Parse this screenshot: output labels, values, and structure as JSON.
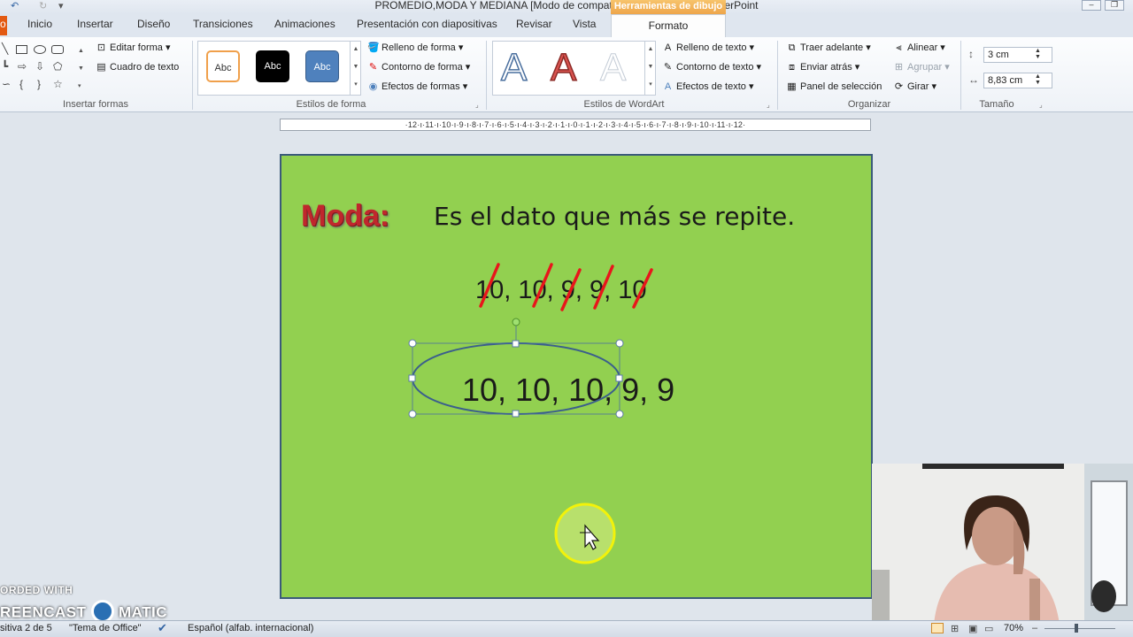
{
  "window": {
    "title": "PROMEDIO,MODA Y MEDIANA [Modo de compatibilidad]  -  Microsoft PowerPoint",
    "contextual_title": "Herramientas de dibujo"
  },
  "tabs": [
    {
      "label": "o"
    },
    {
      "label": "Inicio"
    },
    {
      "label": "Insertar"
    },
    {
      "label": "Diseño"
    },
    {
      "label": "Transiciones"
    },
    {
      "label": "Animaciones"
    },
    {
      "label": "Presentación con diapositivas"
    },
    {
      "label": "Revisar"
    },
    {
      "label": "Vista"
    },
    {
      "label": "Formato"
    }
  ],
  "ribbon": {
    "insertar_formas": {
      "label": "Insertar formas",
      "editar_forma": "Editar forma",
      "cuadro_texto": "Cuadro de texto"
    },
    "estilos_forma": {
      "label": "Estilos de forma",
      "samples": [
        "Abc",
        "Abc",
        "Abc"
      ],
      "relleno": "Relleno de forma",
      "contorno": "Contorno de forma",
      "efectos": "Efectos de formas"
    },
    "estilos_wordart": {
      "label": "Estilos de WordArt",
      "sample_letter": "A",
      "relleno_texto": "Relleno de texto",
      "contorno_texto": "Contorno de texto",
      "efectos_texto": "Efectos de texto"
    },
    "organizar": {
      "label": "Organizar",
      "traer_adelante": "Traer adelante",
      "enviar_atras": "Enviar atrás",
      "panel_seleccion": "Panel de selección",
      "alinear": "Alinear",
      "agrupar": "Agrupar",
      "girar": "Girar"
    },
    "tamano": {
      "label": "Tamaño",
      "alto": "3 cm",
      "ancho": "8,83 cm"
    }
  },
  "ruler": {
    "text": "·12·ı·11·ı·10·ı·9·ı·8·ı·7·ı·6·ı·5·ı·4·ı·3·ı·2·ı·1·ı·0·ı·1·ı·2·ı·3·ı·4·ı·5·ı·6·ı·7·ı·8·ı·9·ı·10·ı·11·ı·12·"
  },
  "slide": {
    "heading": "Moda:",
    "definition": "Es el dato que más se repite.",
    "list_crossed": "10, 10, 9, 9, 10",
    "list_sorted": "10, 10, 10, 9, 9"
  },
  "watermark": {
    "line1": "ORDED WITH",
    "line2a": "REENCAST",
    "line2b": "MATIC"
  },
  "statusbar": {
    "slide_info": "sitiva 2 de 5",
    "theme": "\"Tema de Office\"",
    "language": "Español (alfab. internacional)",
    "zoom": "70%"
  },
  "colors": {
    "slide_bg": "#92d050",
    "heading": "#c0272d",
    "strike": "#e8161b",
    "ellipse": "#3b5f8c",
    "contextual_tab": "#eea54a"
  }
}
